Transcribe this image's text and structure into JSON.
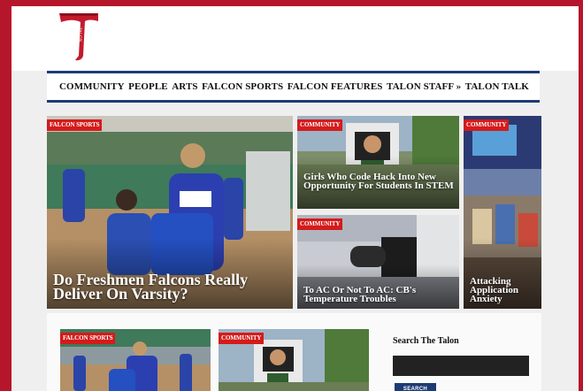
{
  "logo": {
    "text": "TALON",
    "color": "#c21a2c"
  },
  "nav": {
    "items": [
      "COMMUNITY",
      "PEOPLE",
      "ARTS",
      "FALCON SPORTS",
      "FALCON FEATURES",
      "TALON STAFF »",
      "TALON TALK"
    ]
  },
  "featured": [
    {
      "category": "FALCON SPORTS",
      "headline": "Do Freshmen Falcons Really Deliver On Varsity?"
    },
    {
      "category": "COMMUNITY",
      "headline": "Girls Who Code Hack Into New Opportunity For Students In STEM"
    },
    {
      "category": "COMMUNITY",
      "headline": "To AC Or Not To AC: CB's Temperature Troubles"
    },
    {
      "category": "COMMUNITY",
      "headline": "Attacking Application Anxiety"
    }
  ],
  "lower": {
    "cards": [
      {
        "category": "FALCON SPORTS"
      },
      {
        "category": "COMMUNITY"
      }
    ]
  },
  "sidebar": {
    "search_title": "Search The Talon",
    "search_placeholder": "",
    "search_button": "SEARCH"
  }
}
